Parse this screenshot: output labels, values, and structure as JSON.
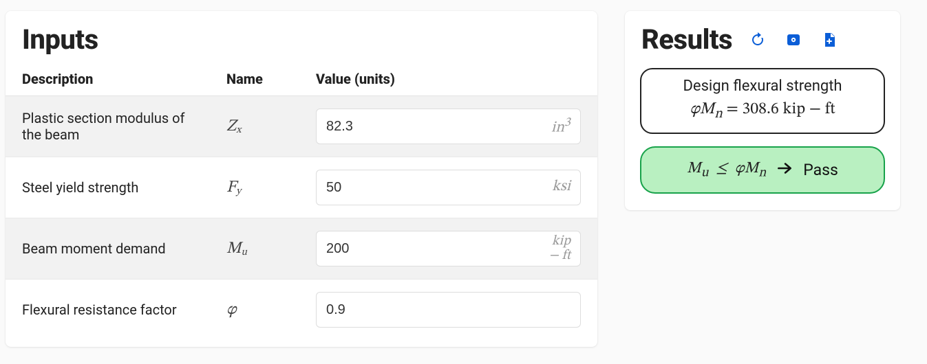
{
  "inputs": {
    "title": "Inputs",
    "headers": {
      "desc": "Description",
      "name": "Name",
      "value": "Value (units)"
    },
    "rows": [
      {
        "desc": "Plastic section modulus of the beam",
        "value": "82.3",
        "unit_html": "in<sup>3</sup>",
        "sym_html": "Z<sub>x</sub>"
      },
      {
        "desc": "Steel yield strength",
        "value": "50",
        "unit_html": "ksi",
        "sym_html": "F<sub>y</sub>"
      },
      {
        "desc": "Beam moment demand",
        "value": "200",
        "unit_html": "<span class='tight'>kip</span><span class='tight'>&minus; ft</span>",
        "sym_html": "M<sub>u</sub>"
      },
      {
        "desc": "Flexural resistance factor",
        "value": "0.9",
        "unit_html": "",
        "sym_html": "&phi;"
      }
    ]
  },
  "results": {
    "title": "Results",
    "design_strength": {
      "label": "Design flexural strength",
      "equation_html": "<i>&phi;M<sub>n</sub></i> = 308.6 <span class='unit-rm'>kip &minus; ft</span>"
    },
    "check": {
      "equation_html": "M<sub>u</sub> &nbsp;&le;&nbsp; &phi;M<sub>n</sub>",
      "status": "Pass"
    },
    "icons": {
      "refresh": "refresh",
      "preview": "preview",
      "add_note": "add-note"
    }
  },
  "colors": {
    "accent": "#0b5ed7",
    "pass_border": "#17a24a",
    "pass_fill": "#b9f0c1"
  }
}
